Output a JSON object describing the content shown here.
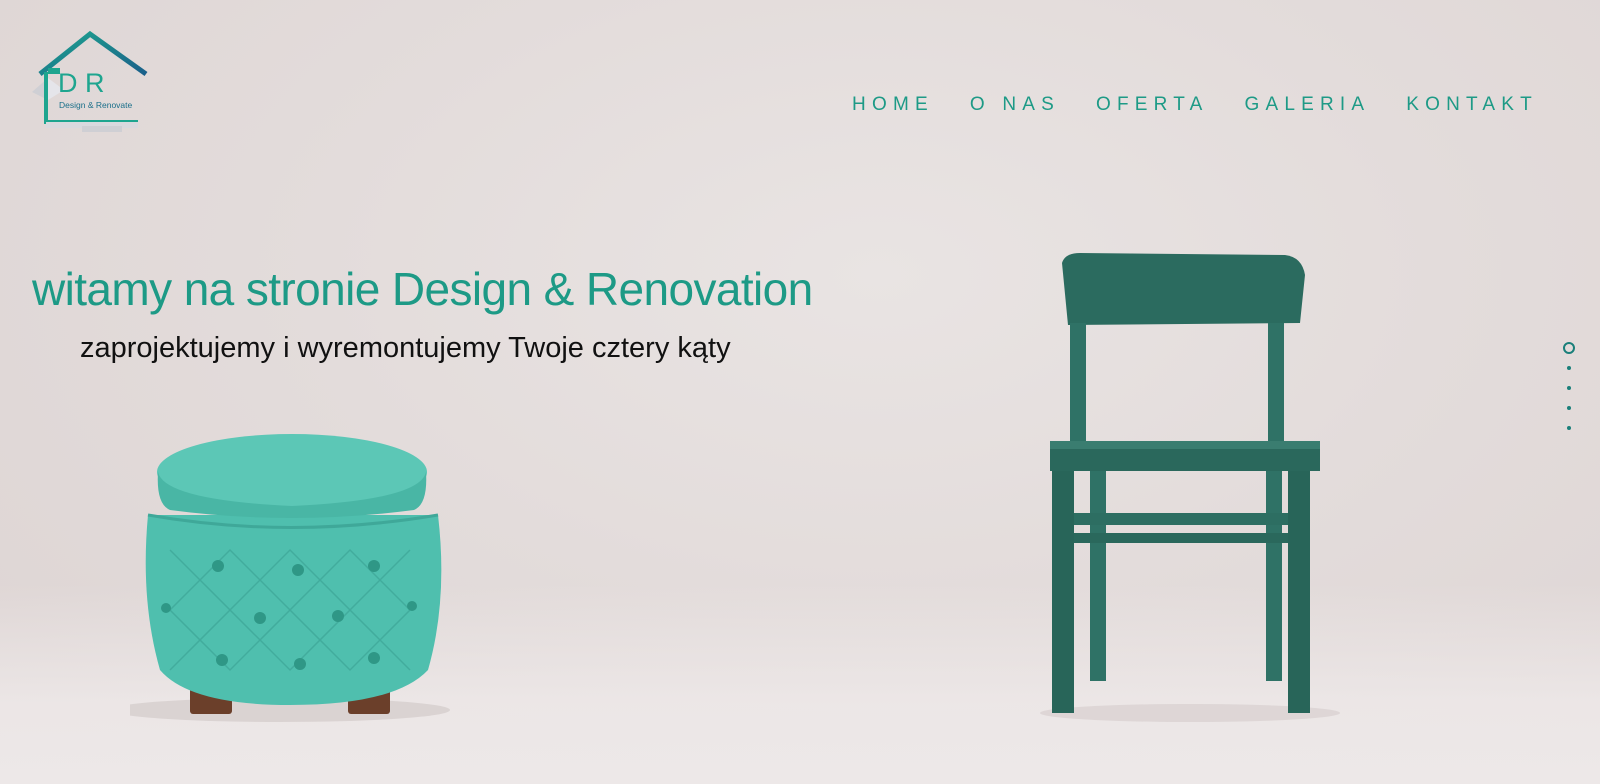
{
  "brand": {
    "logo_letters": "D R",
    "logo_tagline": "Design & Renovate"
  },
  "nav": {
    "items": [
      "HOME",
      "O NAS",
      "OFERTA",
      "GALERIA",
      "KONTAKT"
    ]
  },
  "hero": {
    "title": "witamy na stronie Design & Renovation",
    "subtitle": "zaprojektujemy i wyremontujemy Twoje cztery kąty"
  },
  "slider": {
    "slide_count": 5,
    "active_index": 0
  },
  "colors": {
    "accent": "#1d9a86",
    "text_dark": "#111111",
    "ottoman": "#5cc7b6",
    "chair": "#2b6b5f"
  }
}
